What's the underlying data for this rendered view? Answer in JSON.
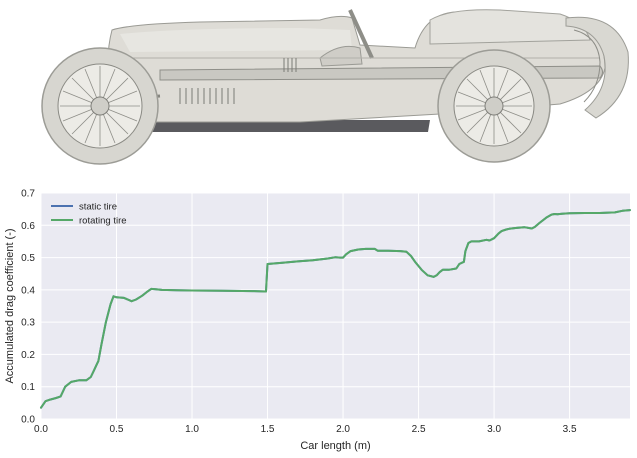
{
  "colors": {
    "plot_bg": "#eaeaf2",
    "grid": "#ffffff",
    "car_body": "#dcdcd6",
    "car_shadow": "#a9a9a3",
    "car_outline": "#8c8c86",
    "tire": "#d6d6d0",
    "dark_trim": "#555558"
  },
  "chart_data": {
    "type": "line",
    "xlabel": "Car length (m)",
    "ylabel": "Accumulated drag coefficient (-)",
    "xlim": [
      0,
      3.9
    ],
    "ylim": [
      0,
      0.7
    ],
    "xticks": [
      0.0,
      0.5,
      1.0,
      1.5,
      2.0,
      2.5,
      3.0,
      3.5
    ],
    "xtick_labels": [
      "0.0",
      "0.5",
      "1.0",
      "1.5",
      "2.0",
      "2.5",
      "3.0",
      "3.5"
    ],
    "yticks": [
      0.0,
      0.1,
      0.2,
      0.3,
      0.4,
      0.5,
      0.6,
      0.7
    ],
    "ytick_labels": [
      "0.0",
      "0.1",
      "0.2",
      "0.3",
      "0.4",
      "0.5",
      "0.6",
      "0.7"
    ],
    "grid": true,
    "legend_position": "top-left",
    "series": [
      {
        "name": "static tire",
        "color": "#4c72b0",
        "x": [
          0.0,
          0.03,
          0.06,
          0.1,
          0.13,
          0.16,
          0.2,
          0.25,
          0.3,
          0.33,
          0.35,
          0.37,
          0.38,
          0.4,
          0.43,
          0.46,
          0.48,
          0.5,
          0.55,
          0.6,
          0.63,
          0.67,
          0.7,
          0.73,
          0.76,
          0.8,
          0.9,
          1.0,
          1.2,
          1.4,
          1.49,
          1.5,
          1.6,
          1.7,
          1.8,
          1.9,
          1.95,
          1.98,
          2.0,
          2.02,
          2.05,
          2.1,
          2.15,
          2.2,
          2.21,
          2.23,
          2.3,
          2.38,
          2.42,
          2.45,
          2.48,
          2.52,
          2.56,
          2.6,
          2.62,
          2.64,
          2.66,
          2.7,
          2.75,
          2.77,
          2.8,
          2.81,
          2.83,
          2.85,
          2.9,
          2.95,
          2.97,
          3.0,
          3.03,
          3.05,
          3.08,
          3.1,
          3.15,
          3.2,
          3.25,
          3.27,
          3.3,
          3.35,
          3.38,
          3.4,
          3.42,
          3.45,
          3.5,
          3.6,
          3.7,
          3.8,
          3.85,
          3.9
        ],
        "y": [
          0.035,
          0.055,
          0.06,
          0.065,
          0.07,
          0.1,
          0.115,
          0.12,
          0.12,
          0.13,
          0.15,
          0.17,
          0.18,
          0.23,
          0.3,
          0.355,
          0.38,
          0.377,
          0.375,
          0.365,
          0.37,
          0.382,
          0.393,
          0.403,
          0.402,
          0.4,
          0.399,
          0.398,
          0.397,
          0.396,
          0.395,
          0.48,
          0.484,
          0.488,
          0.492,
          0.497,
          0.501,
          0.5,
          0.5,
          0.51,
          0.52,
          0.525,
          0.527,
          0.527,
          0.527,
          0.521,
          0.521,
          0.52,
          0.518,
          0.505,
          0.485,
          0.462,
          0.445,
          0.44,
          0.445,
          0.455,
          0.462,
          0.462,
          0.466,
          0.48,
          0.487,
          0.52,
          0.545,
          0.55,
          0.55,
          0.555,
          0.553,
          0.56,
          0.575,
          0.582,
          0.587,
          0.589,
          0.592,
          0.594,
          0.59,
          0.595,
          0.607,
          0.625,
          0.633,
          0.635,
          0.634,
          0.636,
          0.637,
          0.638,
          0.638,
          0.64,
          0.645,
          0.647
        ]
      },
      {
        "name": "rotating tire",
        "color": "#55a868",
        "x": [
          0.0,
          0.03,
          0.06,
          0.1,
          0.13,
          0.16,
          0.2,
          0.25,
          0.3,
          0.33,
          0.35,
          0.37,
          0.38,
          0.4,
          0.43,
          0.46,
          0.48,
          0.5,
          0.55,
          0.6,
          0.63,
          0.67,
          0.7,
          0.73,
          0.76,
          0.8,
          0.9,
          1.0,
          1.2,
          1.4,
          1.49,
          1.5,
          1.6,
          1.7,
          1.8,
          1.9,
          1.95,
          1.98,
          2.0,
          2.02,
          2.05,
          2.1,
          2.15,
          2.2,
          2.21,
          2.23,
          2.3,
          2.38,
          2.42,
          2.45,
          2.48,
          2.52,
          2.56,
          2.6,
          2.62,
          2.64,
          2.66,
          2.7,
          2.75,
          2.77,
          2.8,
          2.81,
          2.83,
          2.85,
          2.9,
          2.95,
          2.97,
          3.0,
          3.03,
          3.05,
          3.08,
          3.1,
          3.15,
          3.2,
          3.25,
          3.27,
          3.3,
          3.35,
          3.38,
          3.4,
          3.42,
          3.45,
          3.5,
          3.6,
          3.7,
          3.8,
          3.85,
          3.9
        ],
        "y": [
          0.035,
          0.055,
          0.06,
          0.065,
          0.07,
          0.1,
          0.115,
          0.12,
          0.12,
          0.13,
          0.15,
          0.17,
          0.18,
          0.23,
          0.3,
          0.355,
          0.38,
          0.377,
          0.375,
          0.365,
          0.37,
          0.382,
          0.393,
          0.403,
          0.402,
          0.4,
          0.399,
          0.398,
          0.397,
          0.396,
          0.395,
          0.48,
          0.484,
          0.488,
          0.492,
          0.497,
          0.501,
          0.5,
          0.5,
          0.51,
          0.52,
          0.525,
          0.527,
          0.527,
          0.527,
          0.521,
          0.521,
          0.52,
          0.518,
          0.505,
          0.485,
          0.462,
          0.445,
          0.44,
          0.445,
          0.455,
          0.462,
          0.462,
          0.466,
          0.48,
          0.487,
          0.52,
          0.545,
          0.55,
          0.55,
          0.555,
          0.553,
          0.56,
          0.575,
          0.582,
          0.587,
          0.589,
          0.592,
          0.594,
          0.59,
          0.595,
          0.607,
          0.625,
          0.633,
          0.635,
          0.634,
          0.636,
          0.637,
          0.638,
          0.638,
          0.64,
          0.645,
          0.647
        ]
      }
    ]
  }
}
